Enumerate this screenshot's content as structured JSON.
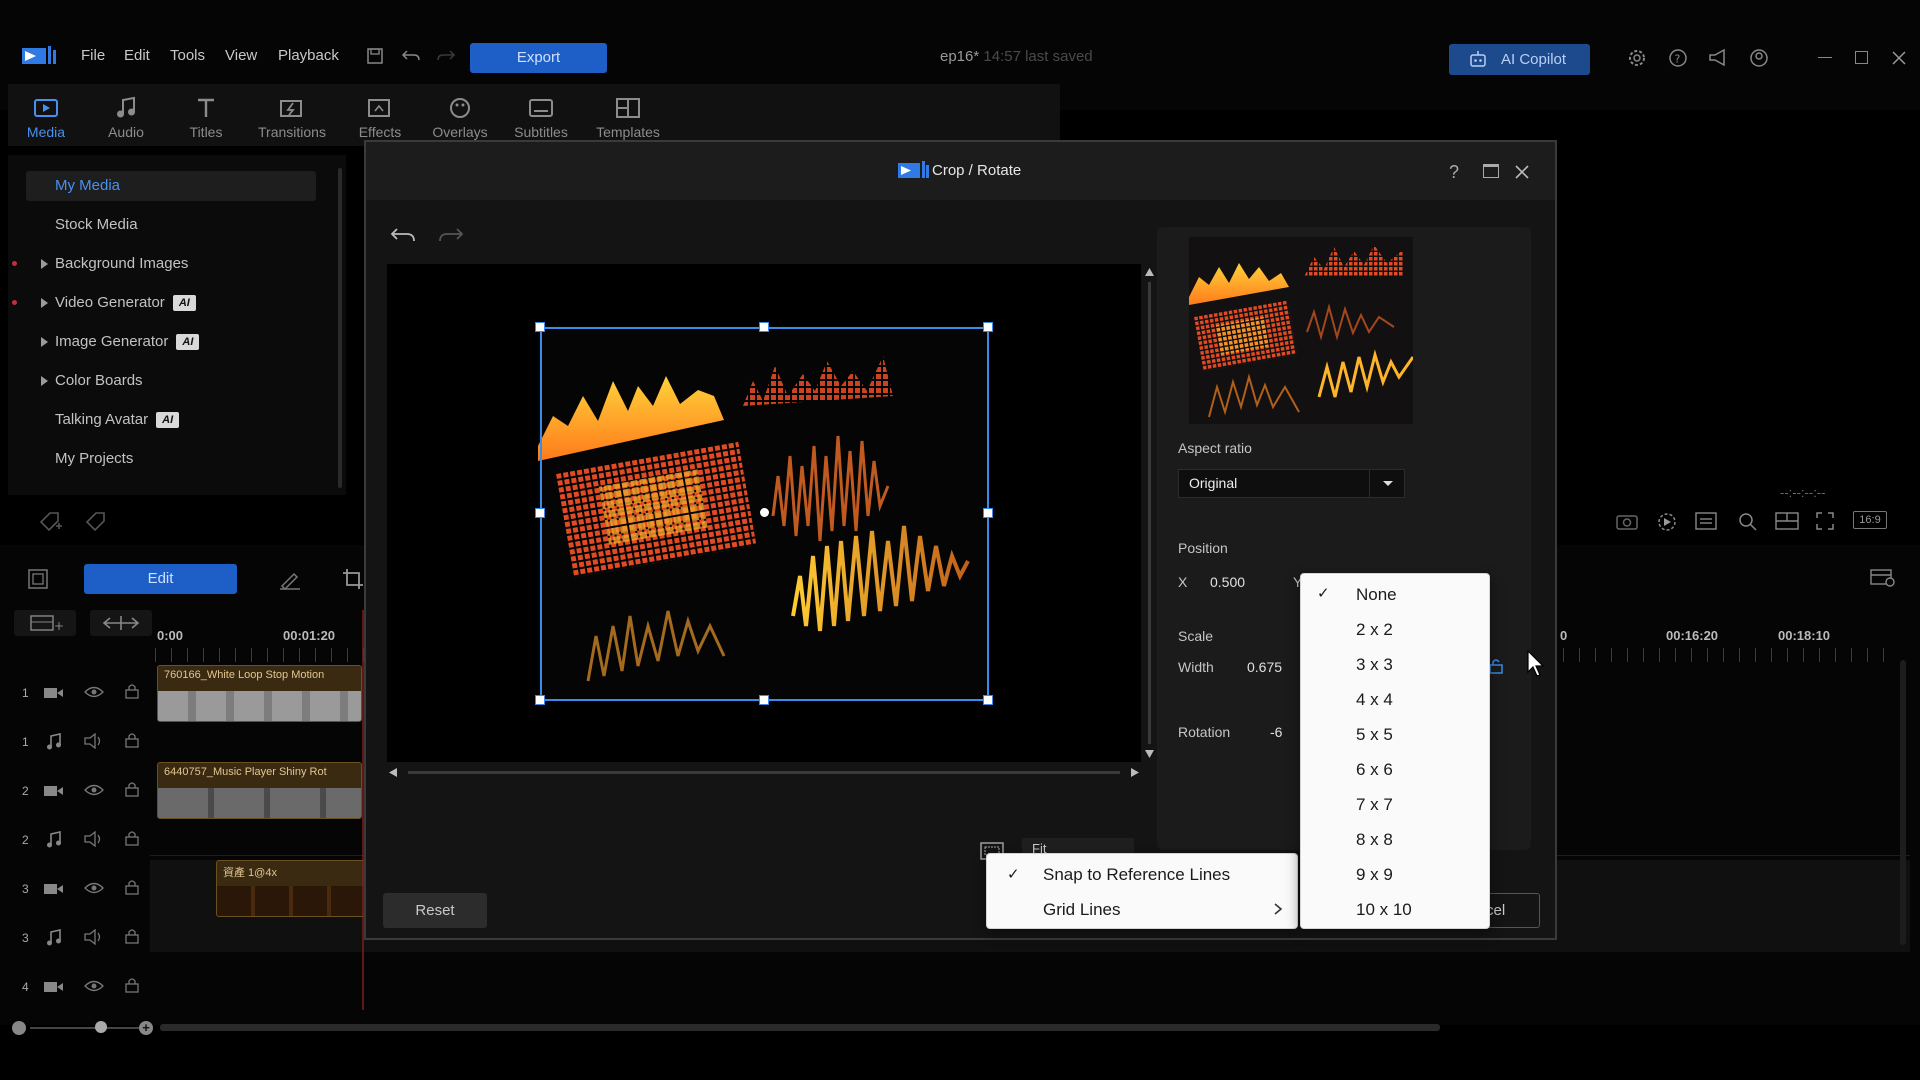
{
  "menubar": {
    "file": "File",
    "edit": "Edit",
    "tools": "Tools",
    "view": "View",
    "playback": "Playback",
    "export": "Export",
    "project_name": "ep16*",
    "last_saved": "14:57 last saved",
    "ai_copilot": "AI Copilot"
  },
  "tabs": [
    "Media",
    "Audio",
    "Titles",
    "Transitions",
    "Effects",
    "Overlays",
    "Subtitles",
    "Templates"
  ],
  "library": {
    "my_media": "My Media",
    "stock_media": "Stock Media",
    "background_images": "Background Images",
    "video_generator": "Video Generator",
    "image_generator": "Image Generator",
    "color_boards": "Color Boards",
    "talking_avatar": "Talking Avatar",
    "my_projects": "My Projects",
    "ai_badge": "AI"
  },
  "timeline": {
    "edit_button": "Edit",
    "ruler_start": "0:00",
    "ruler_t1": "00:01:20",
    "ruler_t2": "0",
    "ruler_t3": "00:16:20",
    "ruler_t4": "00:18:10",
    "timecode": "--:--:--:--",
    "aspect_badge": "16:9",
    "tracks": [
      "1",
      "1",
      "2",
      "2",
      "3",
      "3",
      "4"
    ],
    "clip1": "760166_White Loop Stop Motion",
    "clip2": "6440757_Music Player Shiny Rot",
    "clip3": "資產 1@4x"
  },
  "dialog": {
    "title": "Crop / Rotate",
    "aspect_label": "Aspect ratio",
    "aspect_value": "Original",
    "position_label": "Position",
    "x_label": "X",
    "x_value": "0.500",
    "y_label": "Y",
    "scale_label": "Scale",
    "width_label": "Width",
    "width_value": "0.675",
    "rotation_label": "Rotation",
    "rotation_value": "-6",
    "fit_label": "Fit",
    "reset": "Reset",
    "cancel_partial": "cel"
  },
  "context_menu": {
    "snap": "Snap to Reference Lines",
    "grid": "Grid Lines"
  },
  "grid_submenu": [
    "None",
    "2 x 2",
    "3 x 3",
    "4 x 4",
    "5 x 5",
    "6 x 6",
    "7 x 7",
    "8 x 8",
    "9 x 9",
    "10 x 10"
  ],
  "colors": {
    "accent": "#1d5fc7",
    "brand_blue": "#4a8ff0",
    "selection_border": "#3a8ce8"
  }
}
